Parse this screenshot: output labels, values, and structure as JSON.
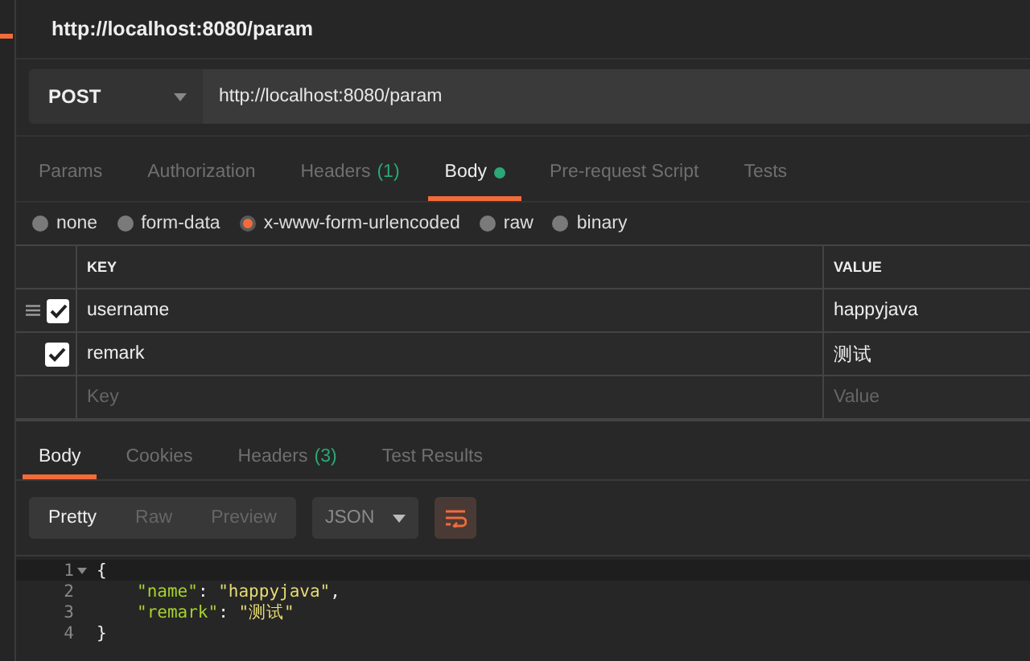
{
  "request_title": "http://localhost:8080/param",
  "url_bar": {
    "method": "POST",
    "url": "http://localhost:8080/param"
  },
  "request_tabs": [
    {
      "label": "Params",
      "selected": false
    },
    {
      "label": "Authorization",
      "selected": false
    },
    {
      "label": "Headers",
      "count": "(1)",
      "selected": false
    },
    {
      "label": "Body",
      "indicator": true,
      "selected": true
    },
    {
      "label": "Pre-request Script",
      "selected": false
    },
    {
      "label": "Tests",
      "selected": false
    }
  ],
  "body_types": [
    {
      "label": "none",
      "selected": false
    },
    {
      "label": "form-data",
      "selected": false
    },
    {
      "label": "x-www-form-urlencoded",
      "selected": true
    },
    {
      "label": "raw",
      "selected": false
    },
    {
      "label": "binary",
      "selected": false
    }
  ],
  "params_table": {
    "columns": [
      "KEY",
      "VALUE"
    ],
    "rows": [
      {
        "kind": "entry",
        "handle": true,
        "checked": true,
        "key": "username",
        "value": "happyjava"
      },
      {
        "kind": "entry",
        "handle": false,
        "checked": true,
        "key": "remark",
        "value": "测试"
      },
      {
        "kind": "new",
        "key_placeholder": "Key",
        "value_placeholder": "Value"
      }
    ]
  },
  "response_tabs": [
    {
      "label": "Body",
      "selected": true
    },
    {
      "label": "Cookies",
      "selected": false
    },
    {
      "label": "Headers",
      "count": "(3)",
      "selected": false
    },
    {
      "label": "Test Results",
      "selected": false
    }
  ],
  "view_modes": [
    {
      "label": "Pretty",
      "selected": true
    },
    {
      "label": "Raw",
      "selected": false
    },
    {
      "label": "Preview",
      "selected": false
    }
  ],
  "format_dropdown": "JSON",
  "wrap_lines": true,
  "code": [
    {
      "number": "1",
      "foldable": true,
      "indented": false,
      "tokens": [
        {
          "kind": "punct",
          "text": "{"
        }
      ]
    },
    {
      "number": "2",
      "indented": true,
      "tokens": [
        {
          "kind": "key",
          "text": "\"name\""
        },
        {
          "kind": "punct",
          "text": ": "
        },
        {
          "kind": "string",
          "text": "\"happyjava\""
        },
        {
          "kind": "punct",
          "text": ","
        }
      ]
    },
    {
      "number": "3",
      "indented": true,
      "tokens": [
        {
          "kind": "key",
          "text": "\"remark\""
        },
        {
          "kind": "punct",
          "text": ": "
        },
        {
          "kind": "string",
          "text": "\"测试\""
        }
      ]
    },
    {
      "number": "4",
      "indented": false,
      "tokens": [
        {
          "kind": "punct",
          "text": "}"
        }
      ]
    }
  ]
}
